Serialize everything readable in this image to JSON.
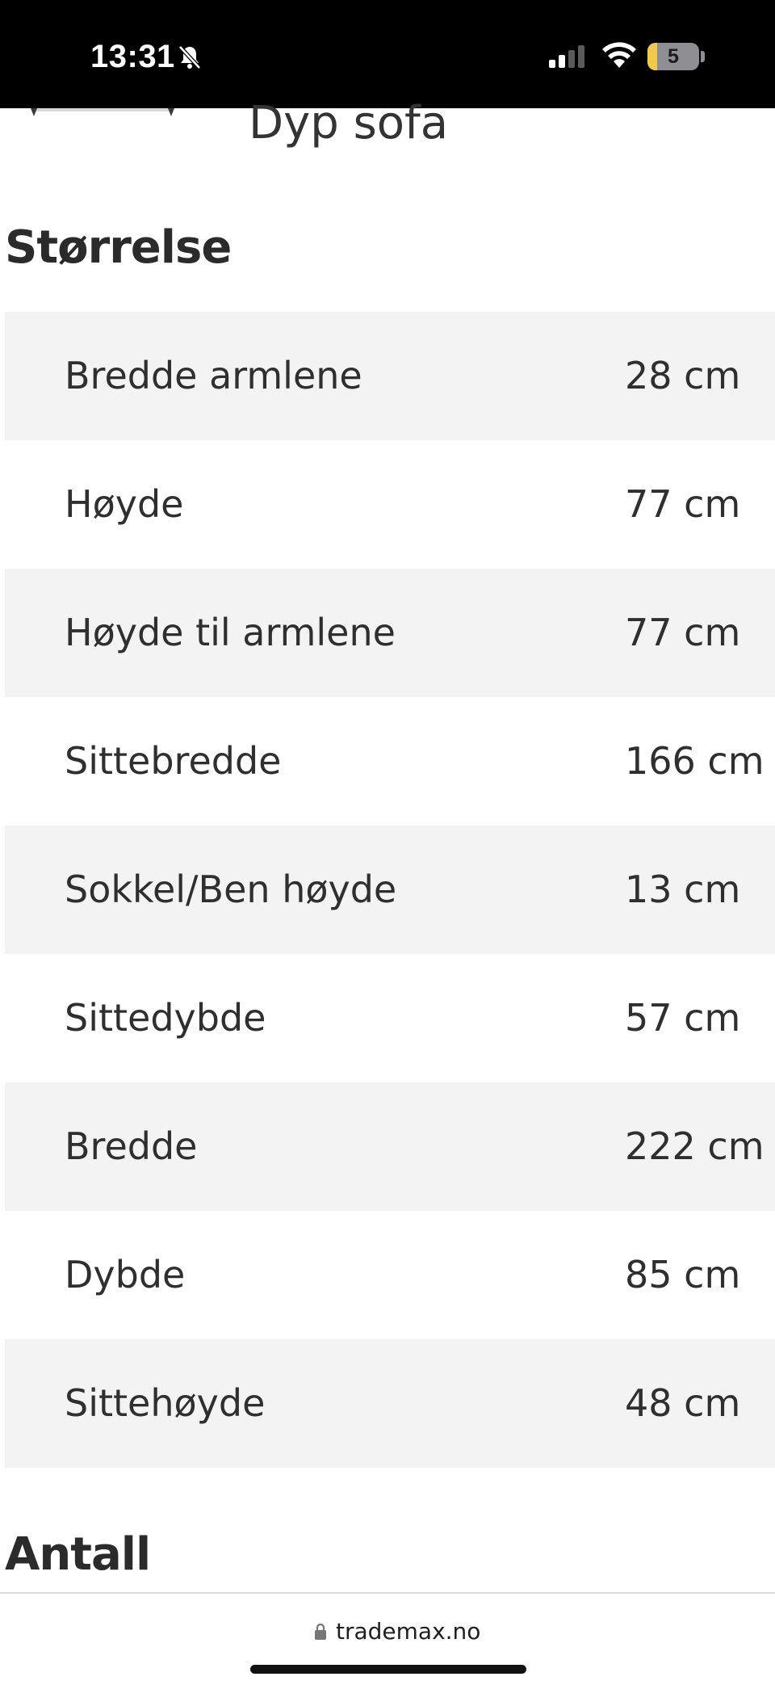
{
  "status_bar": {
    "time": "13:31",
    "battery_level": "5",
    "icons": [
      "bell-off-icon",
      "signal-icon",
      "wifi-icon",
      "battery-icon"
    ]
  },
  "product": {
    "name": "Dyp sofa"
  },
  "size_section": {
    "title": "Størrelse",
    "rows": [
      {
        "label": "Bredde armlene",
        "value": "28 cm"
      },
      {
        "label": "Høyde",
        "value": "77 cm"
      },
      {
        "label": "Høyde til armlene",
        "value": "77 cm"
      },
      {
        "label": "Sittebredde",
        "value": "166 cm"
      },
      {
        "label": "Sokkel/Ben høyde",
        "value": "13 cm"
      },
      {
        "label": "Sittedybde",
        "value": "57 cm"
      },
      {
        "label": "Bredde",
        "value": "222 cm"
      },
      {
        "label": "Dybde",
        "value": "85 cm"
      },
      {
        "label": "Sittehøyde",
        "value": "48 cm"
      }
    ]
  },
  "count_section": {
    "title": "Antall"
  },
  "browser": {
    "url": "trademax.no"
  },
  "colors": {
    "row_shade": "#f3f3f3",
    "text": "#2b2b2b",
    "status_bar": "#000000",
    "battery_fill": "#f2c94c"
  }
}
